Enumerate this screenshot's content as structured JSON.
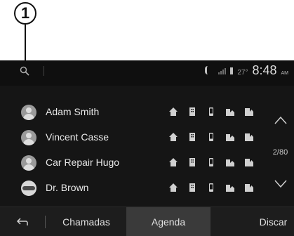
{
  "callout": "1",
  "status": {
    "temperature": "27°",
    "time": "8:48",
    "ampm": "AM"
  },
  "contacts": [
    {
      "name": "Adam Smith",
      "avatar": "person"
    },
    {
      "name": "Vincent Casse",
      "avatar": "person"
    },
    {
      "name": "Car Repair Hugo",
      "avatar": "person"
    },
    {
      "name": "Dr. Brown",
      "avatar": "brand-logo"
    }
  ],
  "contact_icons": [
    "home-phone-icon",
    "office-phone-icon",
    "mobile-phone-icon",
    "home-office-icon",
    "work-office-icon"
  ],
  "pagination": {
    "text": "2/80"
  },
  "tabs": {
    "calls": "Chamadas",
    "agenda": "Agenda",
    "dial": "Discar"
  },
  "colors": {
    "background": "#151515",
    "active_tab": "#3a3a3a",
    "text": "#e8e8e8"
  }
}
